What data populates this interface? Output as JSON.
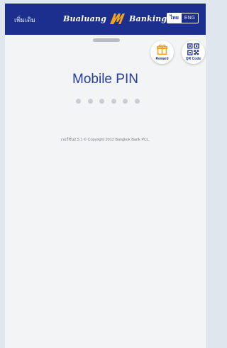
{
  "header": {
    "more_label": "เพิ่มเติม",
    "logo_left": "Bualuang",
    "logo_right": "Banking",
    "lang_th": "ไทย",
    "lang_en": "ENG"
  },
  "actions": {
    "reward_label": "Reward",
    "qr_label": "QR Code"
  },
  "main": {
    "title": "Mobile PIN",
    "pin_length": 6,
    "footer": "เวอร์ชั่น2.5.1 © Copyright 2012 Bangkok Bank PCL."
  },
  "colors": {
    "brand_navy": "#1d2f8e",
    "logo_accent": "#f2a31b"
  }
}
